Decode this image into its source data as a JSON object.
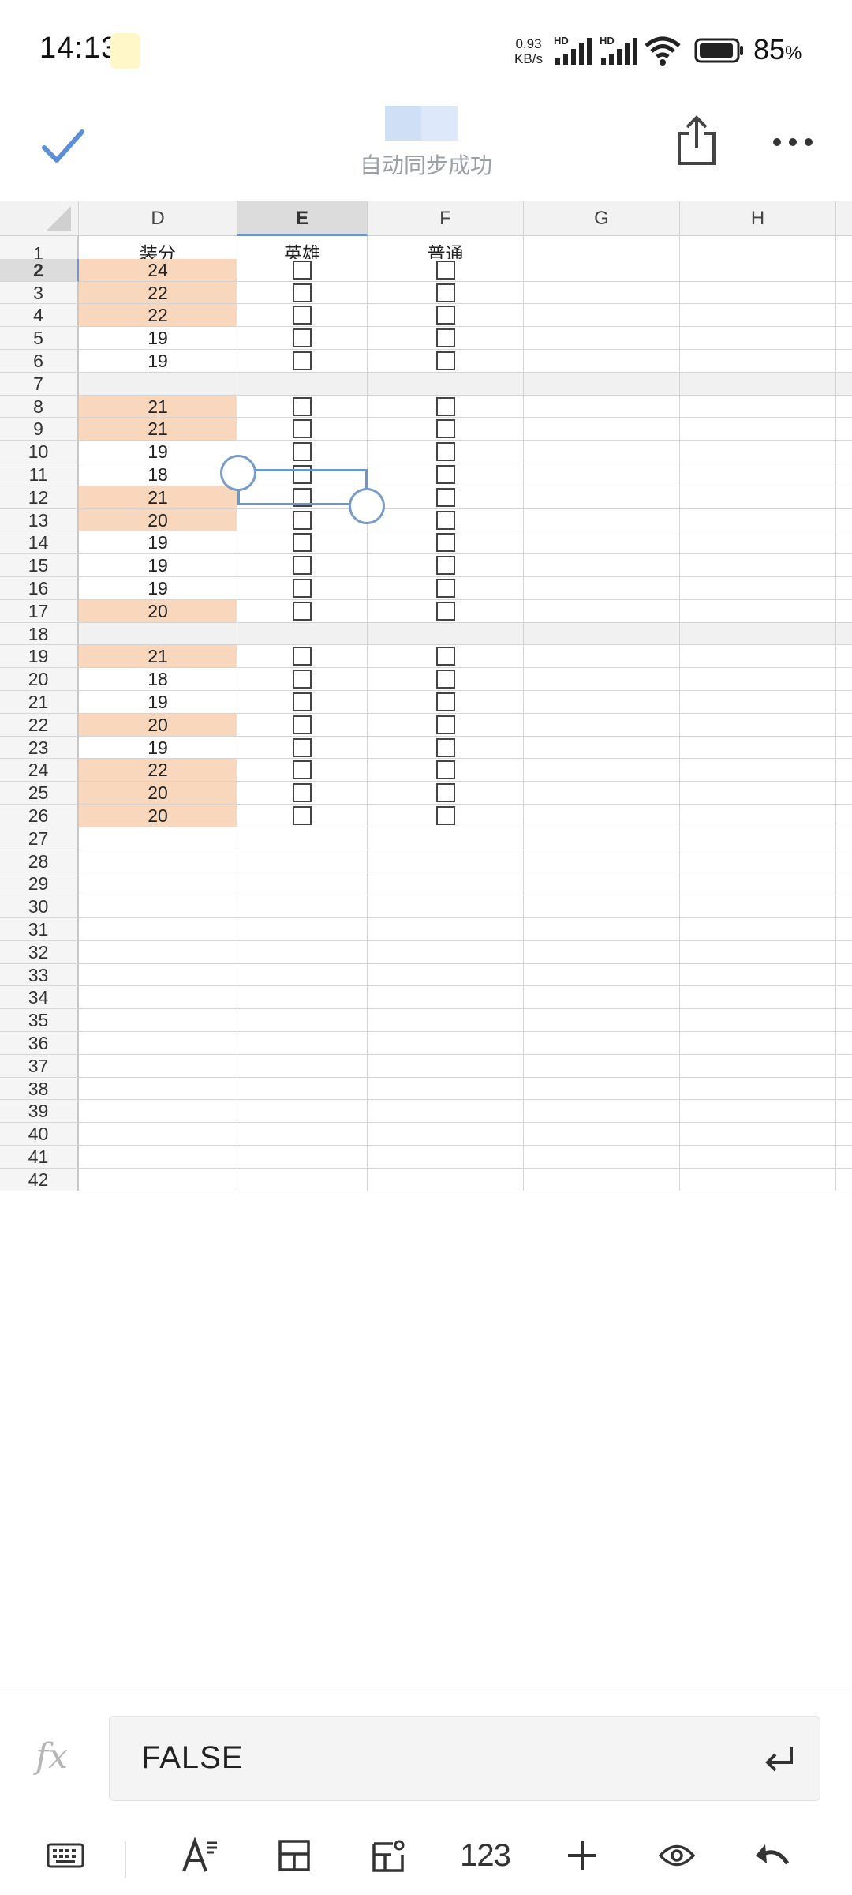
{
  "status": {
    "time": "14:13",
    "net_speed_value": "0.93",
    "net_speed_unit": "KB/s",
    "battery": "85",
    "battery_unit": "%"
  },
  "header": {
    "sync_text": "自动同步成功"
  },
  "columns": [
    "D",
    "E",
    "F",
    "G",
    "H"
  ],
  "selected": {
    "column": "E",
    "row": "2"
  },
  "grid": {
    "header_row": {
      "row": "1",
      "D": "装分",
      "E": "英雄",
      "F": "普通"
    },
    "rows": [
      {
        "n": "2",
        "d": "24",
        "hl": true,
        "cb": true
      },
      {
        "n": "3",
        "d": "22",
        "hl": true,
        "cb": true
      },
      {
        "n": "4",
        "d": "22",
        "hl": true,
        "cb": true
      },
      {
        "n": "5",
        "d": "19",
        "hl": false,
        "cb": true
      },
      {
        "n": "6",
        "d": "19",
        "hl": false,
        "cb": true
      },
      {
        "n": "7",
        "d": "",
        "sep": true
      },
      {
        "n": "8",
        "d": "21",
        "hl": true,
        "cb": true
      },
      {
        "n": "9",
        "d": "21",
        "hl": true,
        "cb": true
      },
      {
        "n": "10",
        "d": "19",
        "hl": false,
        "cb": true
      },
      {
        "n": "11",
        "d": "18",
        "hl": false,
        "cb": true
      },
      {
        "n": "12",
        "d": "21",
        "hl": true,
        "cb": true
      },
      {
        "n": "13",
        "d": "20",
        "hl": true,
        "cb": true
      },
      {
        "n": "14",
        "d": "19",
        "hl": false,
        "cb": true
      },
      {
        "n": "15",
        "d": "19",
        "hl": false,
        "cb": true
      },
      {
        "n": "16",
        "d": "19",
        "hl": false,
        "cb": true
      },
      {
        "n": "17",
        "d": "20",
        "hl": true,
        "cb": true
      },
      {
        "n": "18",
        "d": "",
        "sep": true
      },
      {
        "n": "19",
        "d": "21",
        "hl": true,
        "cb": true
      },
      {
        "n": "20",
        "d": "18",
        "hl": false,
        "cb": true
      },
      {
        "n": "21",
        "d": "19",
        "hl": false,
        "cb": true
      },
      {
        "n": "22",
        "d": "20",
        "hl": true,
        "cb": true
      },
      {
        "n": "23",
        "d": "19",
        "hl": false,
        "cb": true
      },
      {
        "n": "24",
        "d": "22",
        "hl": true,
        "cb": true
      },
      {
        "n": "25",
        "d": "20",
        "hl": true,
        "cb": true
      },
      {
        "n": "26",
        "d": "20",
        "hl": true,
        "cb": true
      },
      {
        "n": "27",
        "d": ""
      },
      {
        "n": "28",
        "d": ""
      },
      {
        "n": "29",
        "d": ""
      },
      {
        "n": "30",
        "d": ""
      },
      {
        "n": "31",
        "d": ""
      },
      {
        "n": "32",
        "d": ""
      },
      {
        "n": "33",
        "d": ""
      },
      {
        "n": "34",
        "d": ""
      },
      {
        "n": "35",
        "d": ""
      },
      {
        "n": "36",
        "d": ""
      },
      {
        "n": "37",
        "d": ""
      },
      {
        "n": "38",
        "d": ""
      },
      {
        "n": "39",
        "d": ""
      },
      {
        "n": "40",
        "d": ""
      },
      {
        "n": "41",
        "d": ""
      },
      {
        "n": "42",
        "d": ""
      }
    ]
  },
  "colors": {
    "highlight": "#f8d7bd",
    "selection": "#6d96cf",
    "separator_row": "#f1f1f1"
  },
  "formula_bar": {
    "fx": "fx",
    "value": "FALSE"
  },
  "toolbar": {
    "items": [
      "keyboard-icon",
      "text-format-icon",
      "cell-format-icon",
      "insert-icon",
      "number-format",
      "add-icon",
      "view-icon",
      "undo-icon"
    ],
    "number_label": "123"
  }
}
